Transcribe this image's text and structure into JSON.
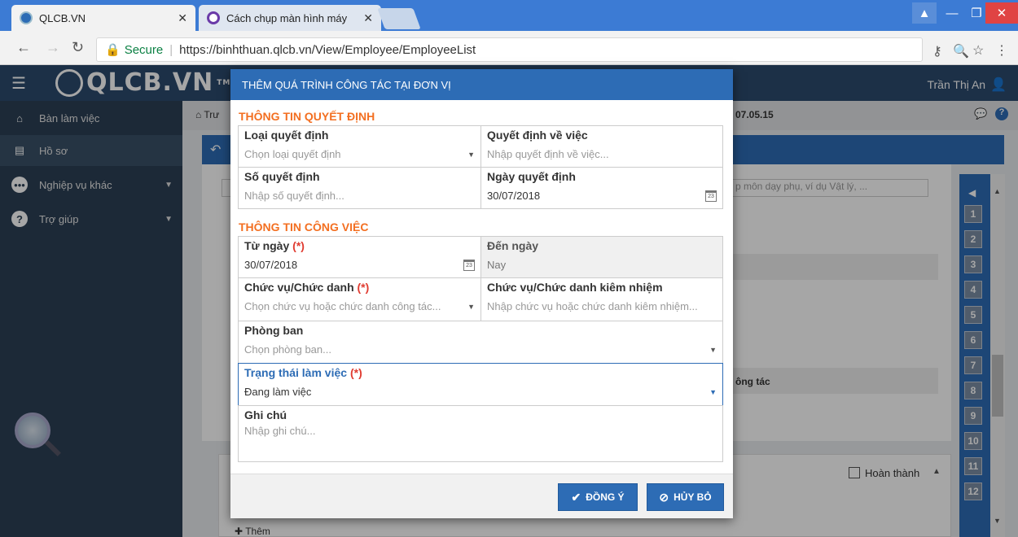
{
  "browser": {
    "tabs": [
      {
        "title": "QLCB.VN"
      },
      {
        "title": "Cách chụp màn hình máy"
      }
    ],
    "secure_label": "Secure",
    "url": "https://binhthuan.qlcb.vn/View/Employee/EmployeeList"
  },
  "app": {
    "logo": "QLCB.VN",
    "logo_tm": "TM",
    "user_name": "Trần Thị An"
  },
  "sidebar": {
    "items": [
      {
        "label": "Bàn làm việc",
        "icon": "home-icon"
      },
      {
        "label": "Hồ sơ",
        "icon": "id-card-icon"
      },
      {
        "label": "Nghiệp vụ khác",
        "icon": "more-icon"
      },
      {
        "label": "Trợ giúp",
        "icon": "help-icon"
      }
    ]
  },
  "background": {
    "breadcrumb_start": "Trư",
    "breadcrumb_end": "07.05.15",
    "search_hint": "p môn dạy phụ, ví dụ Vật lý, ...",
    "cong_tac": "ông tác",
    "hoan_thanh": "Hoàn thành",
    "them": "Thêm",
    "page_numbers": [
      "1",
      "2",
      "3",
      "4",
      "5",
      "6",
      "7",
      "8",
      "9",
      "10",
      "11",
      "12"
    ]
  },
  "modal": {
    "title": "THÊM QUÁ TRÌNH CÔNG TÁC TẠI ĐƠN VỊ",
    "section_decision": "THÔNG TIN QUYẾT ĐỊNH",
    "section_job": "THÔNG TIN CÔNG VIỆC",
    "required_mark": "(*)",
    "fields": {
      "loai_qd": {
        "label": "Loại quyết định",
        "placeholder": "Chọn loại quyết định"
      },
      "qd_ve_viec": {
        "label": "Quyết định về việc",
        "placeholder": "Nhập quyết định về việc..."
      },
      "so_qd": {
        "label": "Số quyết định",
        "placeholder": "Nhập số quyết định..."
      },
      "ngay_qd": {
        "label": "Ngày quyết định",
        "value": "30/07/2018"
      },
      "tu_ngay": {
        "label": "Từ ngày",
        "value": "30/07/2018"
      },
      "den_ngay": {
        "label": "Đến ngày",
        "value": "Nay"
      },
      "chuc_vu": {
        "label": "Chức vụ/Chức danh",
        "placeholder": "Chọn chức vụ hoặc chức danh công tác..."
      },
      "chuc_vu_kiem": {
        "label": "Chức vụ/Chức danh kiêm nhiệm",
        "placeholder": "Nhập chức vụ hoặc chức danh kiêm nhiệm..."
      },
      "phong_ban": {
        "label": "Phòng ban",
        "placeholder": "Chọn phòng ban..."
      },
      "trang_thai": {
        "label": "Trạng thái làm việc",
        "value": "Đang làm việc"
      },
      "ghi_chu": {
        "label": "Ghi chú",
        "placeholder": "Nhập ghi chú..."
      }
    },
    "calendar_day": "23",
    "ok_label": "ĐỒNG Ý",
    "cancel_label": "HỦY BỎ"
  },
  "colors": {
    "primary": "#2d6cb5",
    "section": "#f36f21",
    "required": "#e03c31"
  }
}
